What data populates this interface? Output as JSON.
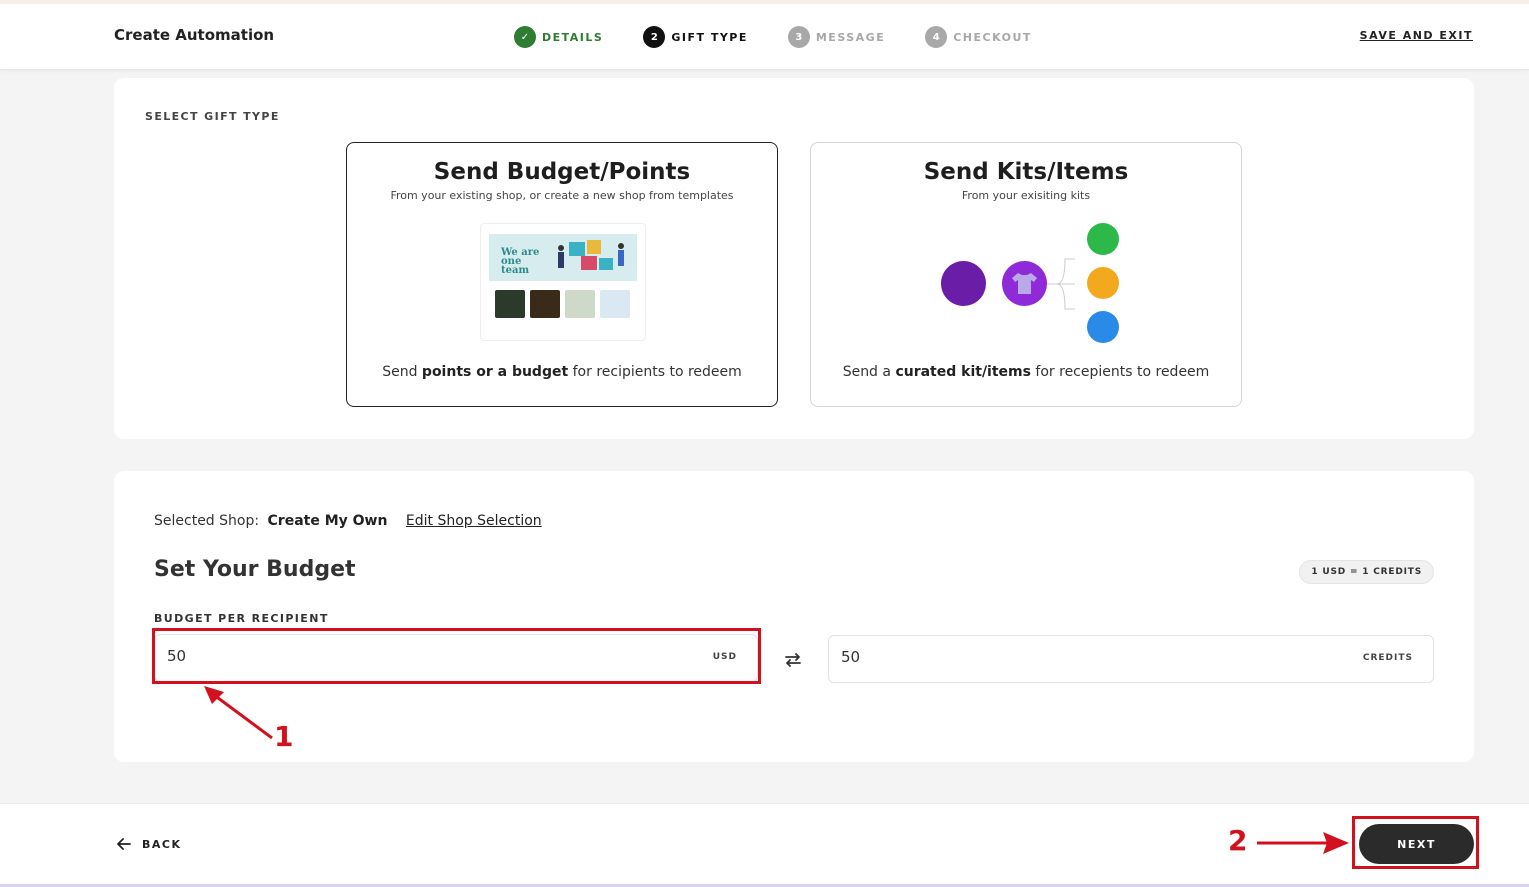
{
  "header": {
    "title": "Create Automation",
    "steps": [
      {
        "number": "✓",
        "label": "DETAILS",
        "state": "done"
      },
      {
        "number": "2",
        "label": "GIFT TYPE",
        "state": "active"
      },
      {
        "number": "3",
        "label": "MESSAGE",
        "state": "todo"
      },
      {
        "number": "4",
        "label": "CHECKOUT",
        "state": "todo"
      }
    ],
    "save_exit": "SAVE AND EXIT"
  },
  "gift_type": {
    "section_label": "SELECT GIFT TYPE",
    "options": [
      {
        "title": "Send Budget/Points",
        "subtitle": "From your existing shop, or create a new shop from templates",
        "desc_pre": "Send ",
        "desc_bold": "points or a budget",
        "desc_post": " for recipients to redeem",
        "selected": true,
        "banner_text": "We are one team"
      },
      {
        "title": "Send Kits/Items",
        "subtitle": "From your exisiting kits",
        "desc_pre": "Send a ",
        "desc_bold": "curated kit/items",
        "desc_post": " for recepients to redeem",
        "selected": false
      }
    ]
  },
  "budget": {
    "selected_shop_label": "Selected Shop:",
    "selected_shop_value": "Create My Own",
    "edit_link": "Edit Shop Selection",
    "title": "Set Your Budget",
    "rate": "1 USD = 1 CREDITS",
    "field_label": "BUDGET PER RECIPIENT",
    "usd_value": "50",
    "usd_unit": "USD",
    "credits_value": "50",
    "credits_unit": "CREDITS"
  },
  "footer": {
    "back": "BACK",
    "next": "NEXT"
  },
  "annotations": {
    "marker_1": "1",
    "marker_2": "2",
    "color": "#d3101d"
  }
}
